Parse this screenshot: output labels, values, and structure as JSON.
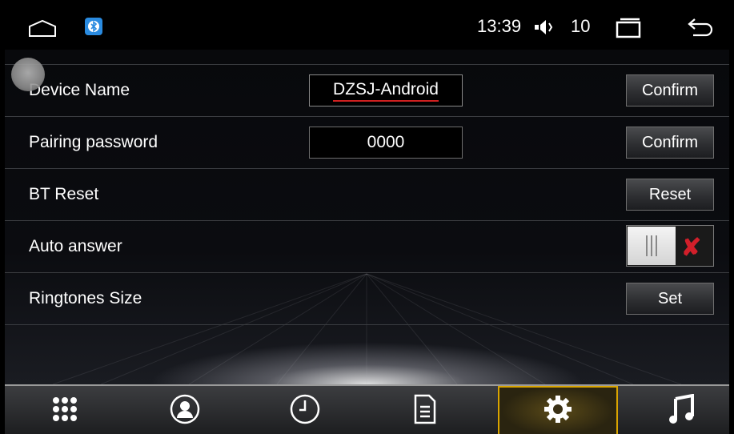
{
  "status_bar": {
    "time": "13:39",
    "volume_level": "10",
    "icons": [
      "home-icon",
      "bluetooth-icon",
      "volume-icon",
      "recent-apps-icon",
      "back-icon"
    ]
  },
  "settings": {
    "rows": [
      {
        "label": "Device Name",
        "field_value": "DZSJ-Android",
        "button_label": "Confirm"
      },
      {
        "label": "Pairing password",
        "field_value": "0000",
        "button_label": "Confirm"
      },
      {
        "label": "BT Reset",
        "button_label": "Reset"
      },
      {
        "label": "Auto answer",
        "toggle_state": "off"
      },
      {
        "label": "Ringtones Size",
        "button_label": "Set"
      }
    ]
  },
  "tabs": [
    {
      "icon": "dialpad-icon",
      "active": false
    },
    {
      "icon": "contacts-icon",
      "active": false
    },
    {
      "icon": "call-history-icon",
      "active": false
    },
    {
      "icon": "phone-transfer-icon",
      "active": false
    },
    {
      "icon": "settings-icon",
      "active": true
    },
    {
      "icon": "music-icon",
      "active": false
    }
  ],
  "colors": {
    "accent": "#d9a400",
    "toggle_off": "#d21f2a",
    "spellcheck": "#d02020"
  }
}
